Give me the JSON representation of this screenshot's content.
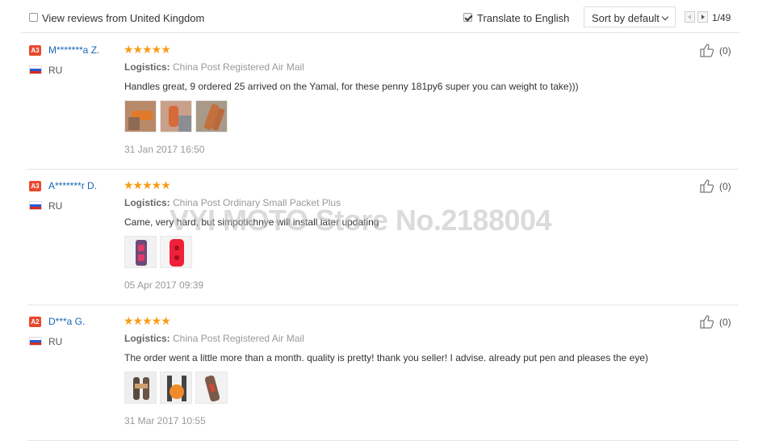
{
  "filters": {
    "view_uk_label": "View reviews from United Kingdom",
    "view_uk_checked": false,
    "translate_label": "Translate to English",
    "translate_checked": true,
    "sort_label": "Sort by default",
    "page_info": "1/49"
  },
  "reviews": [
    {
      "level": "A3",
      "name": "M*******a Z.",
      "country": "RU",
      "stars": "★★★★★",
      "logistics_label": "Logistics:",
      "logistics_value": "China Post Registered Air Mail",
      "text": "Handles great, 9 ordered 25 arrived on the Yamal, for these penny 181py6 super you can weight to take)))",
      "date": "31 Jan 2017 16:50",
      "helpful": "(0)",
      "photos": [
        "photo-1",
        "photo-2",
        "photo-3"
      ]
    },
    {
      "level": "A3",
      "name": "A*******r D.",
      "country": "RU",
      "stars": "★★★★★",
      "logistics_label": "Logistics:",
      "logistics_value": "China Post Ordinary Small Packet Plus",
      "text": "Came, very hard, but simpotichnye will install later updating",
      "date": "05 Apr 2017 09:39",
      "helpful": "(0)",
      "photos": [
        "photo-1",
        "photo-2"
      ]
    },
    {
      "level": "A2",
      "name": "D***a G.",
      "country": "RU",
      "stars": "★★★★★",
      "logistics_label": "Logistics:",
      "logistics_value": "China Post Registered Air Mail",
      "text": "The order went a little more than a month. quality is pretty! thank you seller! I advise. already put pen and pleases the eye)",
      "date": "31 Mar 2017 10:55",
      "helpful": "(0)",
      "photos": [
        "photo-1",
        "photo-2",
        "photo-3"
      ]
    }
  ],
  "watermark": "VYI MOTO Store No.2188004",
  "colors": {
    "accent_link": "#1865b4",
    "star": "#f79d15",
    "level_badge": "#e8492f"
  }
}
